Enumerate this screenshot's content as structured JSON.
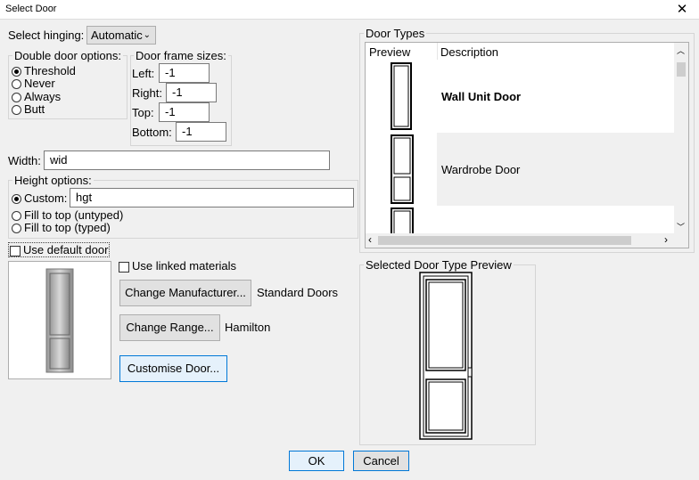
{
  "window": {
    "title": "Select Door",
    "close_glyph": "✕"
  },
  "hinging": {
    "label": "Select hinging:",
    "value": "Automatic"
  },
  "double_door": {
    "legend": "Double door options:",
    "options": [
      "Threshold",
      "Never",
      "Always",
      "Butt"
    ],
    "selected": "Threshold"
  },
  "frame_sizes": {
    "legend": "Door frame sizes:",
    "left_label": "Left:",
    "left_value": "-1",
    "right_label": "Right:",
    "right_value": "-1",
    "top_label": "Top:",
    "top_value": "-1",
    "bottom_label": "Bottom:",
    "bottom_value": "-1"
  },
  "width": {
    "label": "Width:",
    "value": "wid"
  },
  "height_options": {
    "legend": "Height options:",
    "custom_label": "Custom:",
    "custom_value": "hgt",
    "fill_untyped": "Fill to top (untyped)",
    "fill_typed": "Fill to top (typed)",
    "selected": "Custom"
  },
  "use_default_door": {
    "label": "Use default door",
    "checked": false
  },
  "use_linked_materials": {
    "label": "Use linked materials",
    "checked": false
  },
  "manufacturer": {
    "button": "Change Manufacturer...",
    "value": "Standard Doors"
  },
  "range": {
    "button": "Change Range...",
    "value": "Hamilton"
  },
  "customise_button": "Customise Door...",
  "door_types": {
    "legend": "Door Types",
    "columns": [
      "Preview",
      "Description"
    ],
    "rows": [
      {
        "description": "Wall Unit Door",
        "selected": true
      },
      {
        "description": "Wardrobe Door",
        "selected": false
      },
      {
        "description": "",
        "selected": false
      }
    ]
  },
  "selected_preview": {
    "legend": "Selected Door Type Preview"
  },
  "footer": {
    "ok": "OK",
    "cancel": "Cancel"
  },
  "colors": {
    "background": "#f0f0f0",
    "focus_border": "#0078d7",
    "row_alt": "#f0f0f0"
  }
}
